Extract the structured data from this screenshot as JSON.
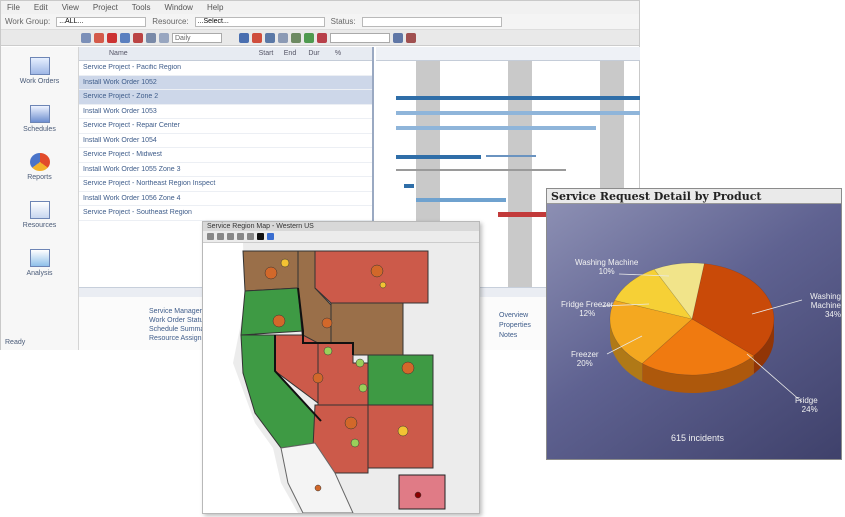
{
  "planner": {
    "menu": [
      "File",
      "Edit",
      "View",
      "Project",
      "Tools",
      "Window",
      "Help"
    ],
    "filter": {
      "label1": "Work Group:",
      "value1": "...ALL...",
      "label2": "Resource:",
      "value2": "...Select...",
      "label3": "Status:",
      "value3": ""
    },
    "toolbar_select": "Daily",
    "toolbar_search": "",
    "nav": [
      "Work Orders",
      "Schedules",
      "Reports",
      "Resources",
      "Analysis"
    ],
    "grid_headers": [
      "Name",
      "Start",
      "End",
      "Dur",
      "%"
    ],
    "rows": [
      {
        "name": "Service Project - Pacific Region",
        "sel": false
      },
      {
        "name": "Install Work Order 1052",
        "sel": true
      },
      {
        "name": "Service Project - Zone 2",
        "sel": true
      },
      {
        "name": "Install Work Order 1053",
        "sel": false
      },
      {
        "name": "Service Project - Repair Center",
        "sel": false
      },
      {
        "name": "Install Work Order 1054",
        "sel": false
      },
      {
        "name": "Service Project - Midwest",
        "sel": false
      },
      {
        "name": "Install Work Order 1055 Zone 3",
        "sel": false
      },
      {
        "name": "Service Project - Northeast Region Inspect",
        "sel": false
      },
      {
        "name": "Install Work Order 1056 Zone 4",
        "sel": false
      },
      {
        "name": "Service Project - Southeast Region",
        "sel": false
      }
    ],
    "bottom_lines": [
      "Service Manager",
      "Work Order Status",
      "Schedule Summary",
      "Resource Assignments"
    ],
    "bottom_links": [
      "Overview",
      "Properties",
      "Notes"
    ],
    "left_bottom": "Ready"
  },
  "map": {
    "title": "Service Region Map - Western US"
  },
  "pie": {
    "title": "Service Request Detail by Product",
    "center_label": "615 incidents",
    "colors": {
      "washer_big": "#c94a08",
      "fridge": "#f07a10",
      "freezer": "#f4a820",
      "fridge_freezer": "#f6d036",
      "washing_small": "#f1e48a"
    },
    "slices": [
      {
        "label": "Washing Machine",
        "pct": "34%",
        "value": 34
      },
      {
        "label": "Fridge",
        "pct": "24%",
        "value": 24
      },
      {
        "label": "Freezer",
        "pct": "20%",
        "value": 20
      },
      {
        "label": "Fridge Freezer",
        "pct": "12%",
        "value": 12
      },
      {
        "label": "Washing Machine",
        "pct": "10%",
        "value": 10
      }
    ]
  }
}
